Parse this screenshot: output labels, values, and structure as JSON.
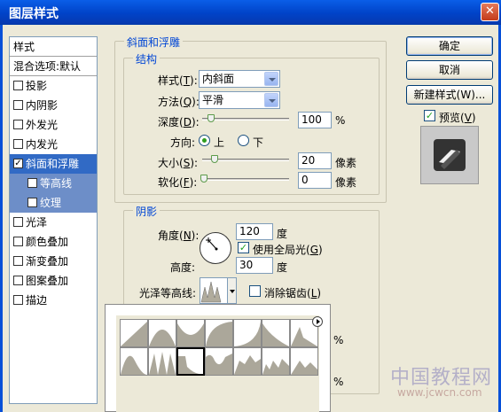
{
  "window": {
    "title": "图层样式",
    "close_glyph": "✕"
  },
  "style_list": {
    "header": "样式",
    "blend": "混合选项:默认",
    "items": [
      {
        "label": "投影",
        "checked": false
      },
      {
        "label": "内阴影",
        "checked": false
      },
      {
        "label": "外发光",
        "checked": false
      },
      {
        "label": "内发光",
        "checked": false
      },
      {
        "label": "斜面和浮雕",
        "checked": true,
        "selected": true
      },
      {
        "label": "等高线",
        "checked": false,
        "sub": true
      },
      {
        "label": "纹理",
        "checked": false,
        "sub": true
      },
      {
        "label": "光泽",
        "checked": false
      },
      {
        "label": "颜色叠加",
        "checked": false
      },
      {
        "label": "渐变叠加",
        "checked": false
      },
      {
        "label": "图案叠加",
        "checked": false
      },
      {
        "label": "描边",
        "checked": false
      }
    ]
  },
  "bevel": {
    "group_title": "斜面和浮雕",
    "structure_title": "结构",
    "style_label": "样式(",
    "style_key": "T",
    "style_value": "内斜面",
    "technique_label": "方法(",
    "technique_key": "Q",
    "technique_value": "平滑",
    "depth_label": "深度(",
    "depth_key": "D",
    "depth_value": "100",
    "depth_unit": "%",
    "direction_label": "方向:",
    "direction_up": "上",
    "direction_down": "下",
    "size_label": "大小(",
    "size_key": "S",
    "size_value": "20",
    "size_unit": "像素",
    "soften_label": "软化(",
    "soften_key": "F",
    "soften_value": "0",
    "soften_unit": "像素",
    "label_close": "):"
  },
  "shading": {
    "title": "阴影",
    "angle_label": "角度(",
    "angle_key": "N",
    "angle_value": "120",
    "angle_unit": "度",
    "global_light_label": "使用全局光(",
    "global_light_key": "G",
    "global_light_close": ")",
    "altitude_label": "高度:",
    "altitude_value": "30",
    "altitude_unit": "度",
    "gloss_label": "光泽等高线:",
    "anti_alias_label": "消除锯齿(",
    "anti_alias_key": "L",
    "anti_alias_close": ")",
    "hidden_unit_1": "%",
    "hidden_unit_2": "%"
  },
  "buttons": {
    "ok": "确定",
    "cancel": "取消",
    "new_style": "新建样式(W)...",
    "preview_label": "预览(",
    "preview_key": "V",
    "preview_close": ")"
  },
  "watermark": {
    "line1": "中国教程网",
    "line2": "www.jcwcn.com"
  },
  "colors": {
    "accent": "#316ac5",
    "title_bar": "#0a5ee8",
    "group_label": "#0046d5"
  }
}
